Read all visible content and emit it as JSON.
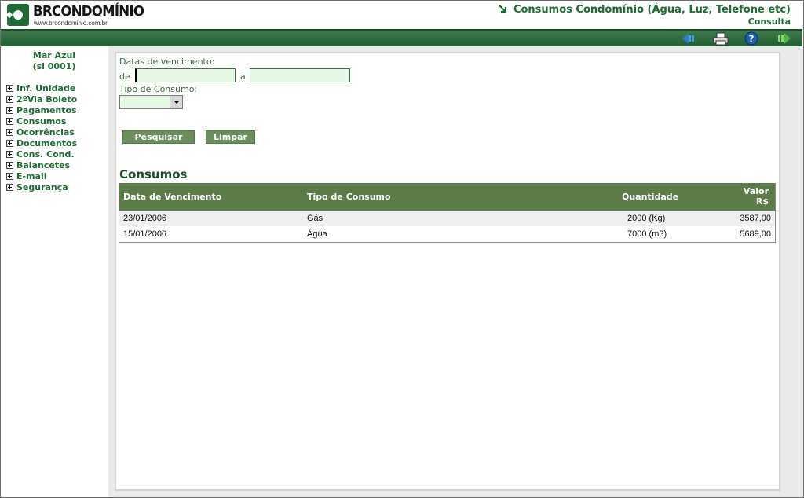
{
  "header": {
    "logo_text": "BRCONDOMÍNIO",
    "logo_sub": "www.brcondominio.com.br",
    "title": "Consumos Condomínio (Água, Luz, Telefone etc)",
    "subtitle": "Consulta"
  },
  "toolbar": {
    "icons": [
      "back-icon",
      "print-icon",
      "help-icon",
      "forward-icon"
    ]
  },
  "sidebar": {
    "unit_name": "Mar Azul",
    "unit_code": "(sl 0001)",
    "items": [
      {
        "label": "Inf. Unidade"
      },
      {
        "label": "2ºVia Boleto"
      },
      {
        "label": "Pagamentos"
      },
      {
        "label": "Consumos"
      },
      {
        "label": "Ocorrências"
      },
      {
        "label": "Documentos"
      },
      {
        "label": "Cons. Cond."
      },
      {
        "label": "Balancetes"
      },
      {
        "label": "E-mail"
      },
      {
        "label": "Segurança"
      }
    ]
  },
  "form": {
    "dates_label": "Datas de vencimento:",
    "from_label": "de",
    "to_label": "a",
    "from_value": "",
    "to_value": "",
    "type_label": "Tipo de Consumo:",
    "type_value": "",
    "search_button": "Pesquisar",
    "clear_button": "Limpar"
  },
  "results": {
    "title": "Consumos",
    "columns": {
      "date": "Data de Vencimento",
      "type": "Tipo de Consumo",
      "quantity": "Quantidade",
      "value_line1": "Valor",
      "value_line2": "R$"
    },
    "rows": [
      {
        "date": "23/01/2006",
        "type": "Gás",
        "quantity": "2000 (Kg)",
        "value": "3587,00"
      },
      {
        "date": "15/01/2006",
        "type": "Água",
        "quantity": "7000 (m3)",
        "value": "5689,00"
      }
    ]
  },
  "colors": {
    "brand_green": "#1e6b33",
    "header_bar": "#2f6b3f",
    "table_header": "#5b7b49",
    "button": "#6a8f5c",
    "input_bg": "#e4f8e4"
  }
}
